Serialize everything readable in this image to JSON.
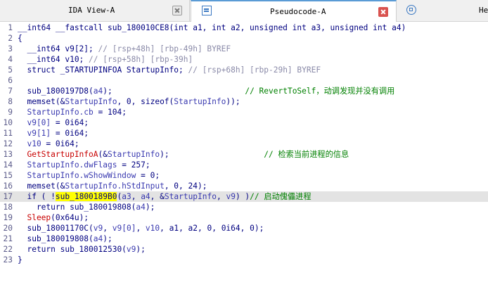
{
  "tabs": {
    "ida_view": {
      "label": "IDA View-A"
    },
    "pseudocode": {
      "label": "Pseudocode-A"
    },
    "hex_view": {
      "label": "He"
    }
  },
  "code": {
    "line_numbers": [
      "1",
      "2",
      "3",
      "4",
      "5",
      "6",
      "7",
      "8",
      "9",
      "10",
      "11",
      "12",
      "13",
      "14",
      "15",
      "16",
      "17",
      "18",
      "19",
      "20",
      "21",
      "22",
      "23"
    ],
    "lines": [
      [
        {
          "t": "__int64 __fastcall sub_180010CE8(int a1, int a2, unsigned int a3, unsigned int a4)",
          "c": "kw"
        }
      ],
      [
        {
          "t": "{",
          "c": "kw"
        }
      ],
      [
        {
          "t": "  __int64 v9[2]; ",
          "c": "kw"
        },
        {
          "t": "// [rsp+48h] [rbp-49h] BYREF",
          "c": "reg"
        }
      ],
      [
        {
          "t": "  __int64 v10; ",
          "c": "kw"
        },
        {
          "t": "// [rsp+58h] [rbp-39h]",
          "c": "reg"
        }
      ],
      [
        {
          "t": "  struct _STARTUPINFOA StartupInfo; ",
          "c": "kw"
        },
        {
          "t": "// [rsp+68h] [rbp-29h] BYREF",
          "c": "reg"
        }
      ],
      [
        {
          "t": "",
          "c": "kw"
        }
      ],
      [
        {
          "t": "  sub_1800197D8(",
          "c": "fn"
        },
        {
          "t": "a4",
          "c": "var"
        },
        {
          "t": ");                            ",
          "c": "fn"
        },
        {
          "t": "// RevertToSelf，动调发现并没有调用",
          "c": "cmt"
        }
      ],
      [
        {
          "t": "  memset(&",
          "c": "fn"
        },
        {
          "t": "StartupInfo",
          "c": "var"
        },
        {
          "t": ", 0, sizeof(",
          "c": "fn"
        },
        {
          "t": "StartupInfo",
          "c": "var"
        },
        {
          "t": "));",
          "c": "fn"
        }
      ],
      [
        {
          "t": "  StartupInfo.cb",
          "c": "var"
        },
        {
          "t": " = 104;",
          "c": "fn"
        }
      ],
      [
        {
          "t": "  v9[0]",
          "c": "var"
        },
        {
          "t": " = 0i64;",
          "c": "fn"
        }
      ],
      [
        {
          "t": "  v9[1]",
          "c": "var"
        },
        {
          "t": " = 0i64;",
          "c": "fn"
        }
      ],
      [
        {
          "t": "  v10",
          "c": "var"
        },
        {
          "t": " = 0i64;",
          "c": "fn"
        }
      ],
      [
        {
          "t": "  GetStartupInfoA",
          "c": "api"
        },
        {
          "t": "(&",
          "c": "fn"
        },
        {
          "t": "StartupInfo",
          "c": "var"
        },
        {
          "t": ");                    ",
          "c": "fn"
        },
        {
          "t": "// 检索当前进程的信息",
          "c": "cmt"
        }
      ],
      [
        {
          "t": "  StartupInfo.dwFlags",
          "c": "var"
        },
        {
          "t": " = 257;",
          "c": "fn"
        }
      ],
      [
        {
          "t": "  StartupInfo.wShowWindow",
          "c": "var"
        },
        {
          "t": " = 0;",
          "c": "fn"
        }
      ],
      [
        {
          "t": "  memset(&",
          "c": "fn"
        },
        {
          "t": "StartupInfo.hStdInput",
          "c": "var"
        },
        {
          "t": ", 0, 24);",
          "c": "fn"
        }
      ],
      [
        {
          "t": "  if ( !",
          "c": "fn"
        },
        {
          "t": "sub_1",
          "c": "hl"
        },
        {
          "t": "800189B0",
          "c": "hl"
        },
        {
          "t": "(",
          "c": "fn"
        },
        {
          "t": "a3",
          "c": "var"
        },
        {
          "t": ", ",
          "c": "fn"
        },
        {
          "t": "a4",
          "c": "var"
        },
        {
          "t": ", &",
          "c": "fn"
        },
        {
          "t": "StartupInfo",
          "c": "var"
        },
        {
          "t": ", ",
          "c": "fn"
        },
        {
          "t": "v9",
          "c": "var"
        },
        {
          "t": ") )",
          "c": "fn"
        },
        {
          "t": "// 启动傀儡进程",
          "c": "cmt"
        }
      ],
      [
        {
          "t": "    return sub_180019808(",
          "c": "fn"
        },
        {
          "t": "a4",
          "c": "var"
        },
        {
          "t": ");",
          "c": "fn"
        }
      ],
      [
        {
          "t": "  Sleep",
          "c": "api"
        },
        {
          "t": "(0x64u);",
          "c": "fn"
        }
      ],
      [
        {
          "t": "  sub_18001170C(",
          "c": "fn"
        },
        {
          "t": "v9",
          "c": "var"
        },
        {
          "t": ", ",
          "c": "fn"
        },
        {
          "t": "v9[0]",
          "c": "var"
        },
        {
          "t": ", ",
          "c": "fn"
        },
        {
          "t": "v10",
          "c": "var"
        },
        {
          "t": ", a1, a2, 0, 0i64, 0);",
          "c": "fn"
        }
      ],
      [
        {
          "t": "  sub_180019808(",
          "c": "fn"
        },
        {
          "t": "a4",
          "c": "var"
        },
        {
          "t": ");",
          "c": "fn"
        }
      ],
      [
        {
          "t": "  return sub_180012530(",
          "c": "fn"
        },
        {
          "t": "v9",
          "c": "var"
        },
        {
          "t": ");",
          "c": "fn"
        }
      ],
      [
        {
          "t": "}",
          "c": "fn"
        }
      ]
    ],
    "current_line": "17"
  },
  "colors": {
    "keyword": "#000080",
    "variable": "#3a3ab0",
    "comment": "#008000",
    "stack_comment": "#8a8aa8",
    "api_call": "#c80000",
    "highlight": "#ffff00",
    "current_line_bg": "#e3e3e3"
  }
}
